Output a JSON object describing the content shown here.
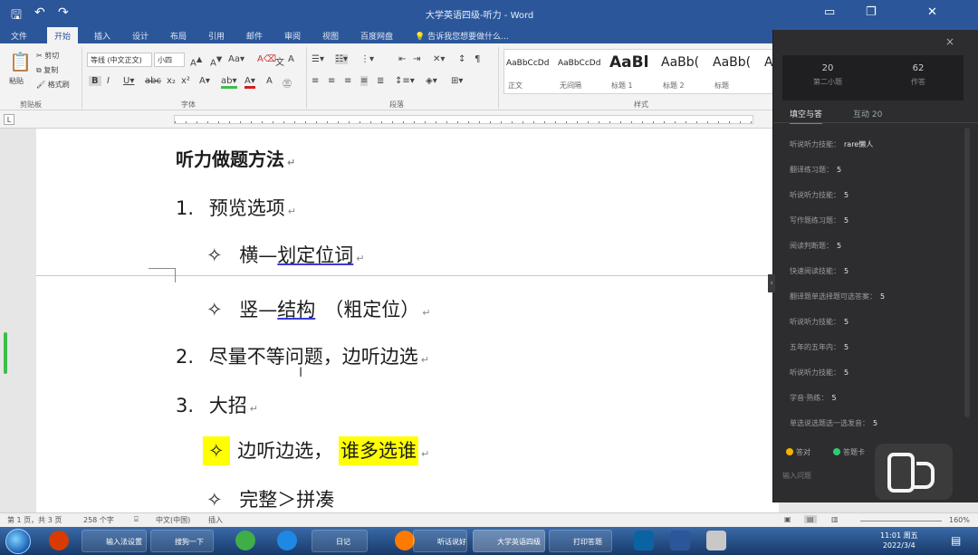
{
  "window": {
    "title": "大学英语四级-听力 - Word",
    "controls": {
      "minimize": "▭",
      "restore": "❐",
      "close": "✕"
    }
  },
  "quick_access": {
    "save": "🖫",
    "undo": "↶",
    "redo": "↷"
  },
  "ribbon": {
    "tabs": [
      "文件",
      "开始",
      "插入",
      "设计",
      "布局",
      "引用",
      "邮件",
      "审阅",
      "视图",
      "百度网盘"
    ],
    "active_tab": "开始",
    "tell_me": "告诉我您想要做什么...",
    "clipboard": {
      "paste": "粘贴",
      "cut": "剪切",
      "copy": "复制",
      "format_painter": "格式刷",
      "label": "剪贴板"
    },
    "font": {
      "name": "等线 (中文正文)",
      "size": "小四",
      "label": "字体"
    },
    "paragraph_label": "段落",
    "styles_label": "样式",
    "styles": [
      {
        "sample": "AaBbCcDd",
        "name": "正文"
      },
      {
        "sample": "AaBbCcDd",
        "name": "无间隔"
      },
      {
        "sample": "AaBl",
        "name": "标题 1"
      },
      {
        "sample": "AaBb(",
        "name": "标题 2"
      },
      {
        "sample": "AaBb(",
        "name": "标题"
      },
      {
        "sample": "A",
        "name": ""
      }
    ]
  },
  "document": {
    "lines": [
      {
        "text": "听力做题方法",
        "bold": true
      },
      {
        "num": "1.",
        "text": "预览选项"
      },
      {
        "bullet": "✧",
        "a": "横—",
        "b": "划定位词"
      },
      {
        "bullet": "✧",
        "a": "竖—",
        "b": "结构",
        "c": "（粗定位）"
      },
      {
        "num": "2.",
        "text": "尽量不等问题，边听边选"
      },
      {
        "num": "3.",
        "text": "大招"
      },
      {
        "bullet": "✧",
        "a": "边听边选，",
        "b": "谁多选谁"
      },
      {
        "bullet": "✧",
        "a": "完整＞拼凑"
      }
    ],
    "para_mark": "↵"
  },
  "status": {
    "page": "第 1 页，共 3 页",
    "words": "258 个字",
    "language": "中文(中国)",
    "mode": "插入",
    "zoom": "160%"
  },
  "panel": {
    "stat_left_num": "20",
    "stat_left_label": "第二小题",
    "stat_right_num": "62",
    "stat_right_label": "作答",
    "tab_active": "填空与答",
    "tab_other": "互动 20",
    "rows": [
      {
        "label": "听说听力技能：",
        "value": "rare懒人"
      },
      {
        "label": "翻译练习题：",
        "value": "5"
      },
      {
        "label": "听说听力技能：",
        "value": "5"
      },
      {
        "label": "写作题练习题：",
        "value": "5"
      },
      {
        "label": "阅读判断题：",
        "value": "5"
      },
      {
        "label": "快速阅读技能：",
        "value": "5"
      },
      {
        "label": "翻译题单选择题可选答案：",
        "value": "5"
      },
      {
        "label": "听说听力技能：",
        "value": "5"
      },
      {
        "label": "五年的五年内：",
        "value": "5"
      },
      {
        "label": "听说听力技能：",
        "value": "5"
      },
      {
        "label": "学音·熟练：",
        "value": "5"
      },
      {
        "label": "单选说选题选一选发音：",
        "value": "5"
      }
    ],
    "legend_a": "答对",
    "legend_b": "答题卡",
    "footer": "输入问题",
    "close": "×",
    "arrow": "‹"
  },
  "taskbar": {
    "items": [
      "输入法设置",
      "搜狗一下",
      "",
      "",
      "日记",
      "听话说好",
      "大学英语四级",
      "打印答题"
    ],
    "time": "11:01 周五",
    "date": "2022/3/4"
  },
  "colors": {
    "word_blue": "#2b579a",
    "highlight": "#ffff00",
    "panel_bg": "#2d2d30",
    "accent": "#3d8bfd",
    "dot_a": "#f5b301",
    "dot_b": "#2ecc71"
  }
}
